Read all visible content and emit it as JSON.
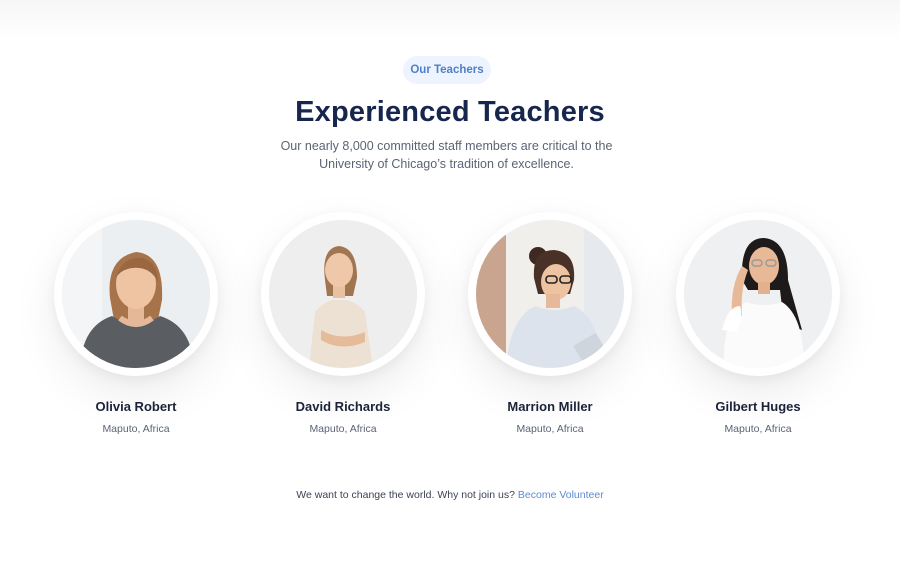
{
  "section": {
    "badge": "Our Teachers",
    "title": "Experienced Teachers",
    "subtitle_line1": "Our nearly 8,000 committed staff members are critical to the",
    "subtitle_line2": "University of Chicago’s tradition of excellence."
  },
  "teachers": [
    {
      "name": "Olivia Robert",
      "location": "Maputo, Africa"
    },
    {
      "name": "David Richards",
      "location": "Maputo, Africa"
    },
    {
      "name": "Marrion Miller",
      "location": "Maputo, Africa"
    },
    {
      "name": "Gilbert Huges",
      "location": "Maputo, Africa"
    }
  ],
  "footer": {
    "text": "We want to change the world. Why not join us?",
    "link": "Become Volunteer"
  },
  "colors": {
    "accent": "#4f80c7",
    "title": "#16264d",
    "link": "#5c8ad3",
    "badge_bg": "#eef4ff"
  }
}
